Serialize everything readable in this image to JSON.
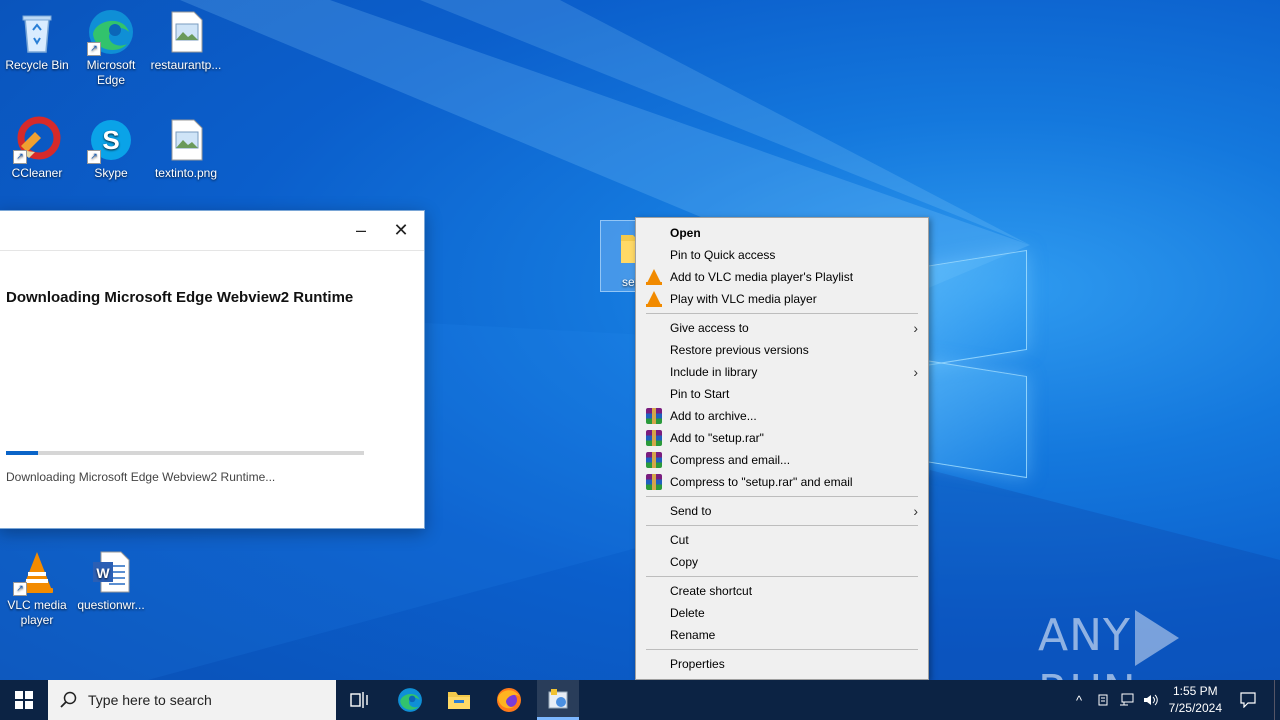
{
  "desktop": {
    "icons": [
      {
        "label": "Recycle Bin"
      },
      {
        "label": "Microsoft Edge"
      },
      {
        "label": "restaurantp..."
      },
      {
        "label": "CCleaner"
      },
      {
        "label": "Skype"
      },
      {
        "label": "textinto.png"
      },
      {
        "label": "VLC media player"
      },
      {
        "label": "questionwr..."
      }
    ],
    "selected_folder_partial_label": "set"
  },
  "installer": {
    "heading": "Downloading Microsoft Edge Webview2 Runtime",
    "status": "Downloading Microsoft Edge Webview2 Runtime...",
    "progress_fraction": 0.09,
    "minimize_glyph": "–",
    "close_glyph": "✕"
  },
  "context_menu": {
    "items": [
      {
        "label": "Open",
        "bold": true
      },
      {
        "label": "Pin to Quick access"
      },
      {
        "label": "Add to VLC media player's Playlist",
        "icon": "vlc-icon"
      },
      {
        "label": "Play with VLC media player",
        "icon": "vlc-icon"
      },
      {
        "label": "Give access to",
        "submenu": true
      },
      {
        "label": "Restore previous versions"
      },
      {
        "label": "Include in library",
        "submenu": true
      },
      {
        "label": "Pin to Start"
      },
      {
        "label": "Add to archive...",
        "icon": "winrar-icon"
      },
      {
        "label": "Add to \"setup.rar\"",
        "icon": "winrar-icon"
      },
      {
        "label": "Compress and email...",
        "icon": "winrar-icon"
      },
      {
        "label": "Compress to \"setup.rar\" and email",
        "icon": "winrar-icon"
      },
      {
        "label": "Send to",
        "submenu": true
      },
      {
        "label": "Cut"
      },
      {
        "label": "Copy"
      },
      {
        "label": "Create shortcut"
      },
      {
        "label": "Delete"
      },
      {
        "label": "Rename"
      },
      {
        "label": "Properties"
      }
    ]
  },
  "watermark": {
    "left": "ANY",
    "right": "RUN"
  },
  "taskbar": {
    "search_placeholder": "Type here to search",
    "time": "1:55 PM",
    "date": "7/25/2024",
    "accent": "#0c2344"
  }
}
